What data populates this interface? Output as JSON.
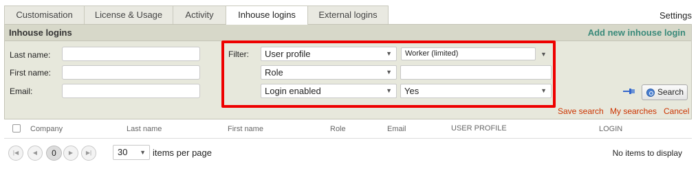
{
  "tabs": [
    "Customisation",
    "License & Usage",
    "Activity",
    "Inhouse logins",
    "External logins"
  ],
  "settings_label": "Settings",
  "panel": {
    "title": "Inhouse logins",
    "add_new": "Add new inhouse login",
    "last_name_label": "Last name:",
    "first_name_label": "First name:",
    "email_label": "Email:",
    "filter_label": "Filter:"
  },
  "filters": [
    {
      "field": "User profile",
      "value": "Worker (limited)"
    },
    {
      "field": "Role",
      "value": ""
    },
    {
      "field": "Login enabled",
      "value": "Yes"
    }
  ],
  "search_button": "Search",
  "actions": {
    "save_search": "Save search",
    "my_searches": "My searches",
    "cancel": "Cancel"
  },
  "columns": [
    "Company",
    "Last name",
    "First name",
    "Role",
    "Email",
    "USER PROFILE",
    "LOGIN"
  ],
  "pager": {
    "current_page": "0",
    "page_size": "30",
    "items_per_page_label": "items per page",
    "status": "No items to display"
  },
  "colors": {
    "accent_link": "#3a8a7a",
    "action_link": "#cc3300",
    "highlight": "#ee0000",
    "panel_bg": "#e7e8dc"
  }
}
